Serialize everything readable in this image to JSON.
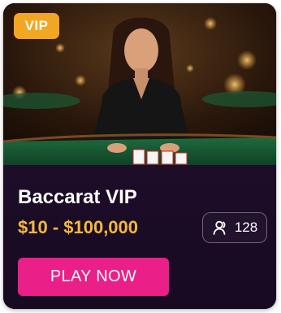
{
  "card": {
    "badge": "VIP",
    "title": "Baccarat VIP",
    "bet_range": "$10 - $100,000",
    "players": {
      "count": "128",
      "icon": "user-icon"
    },
    "cta_label": "PLAY NOW"
  },
  "colors": {
    "badge": "#f3a623",
    "card_background": "#1a0b22",
    "price": "#f5b83d",
    "button": "#ea1f87"
  }
}
